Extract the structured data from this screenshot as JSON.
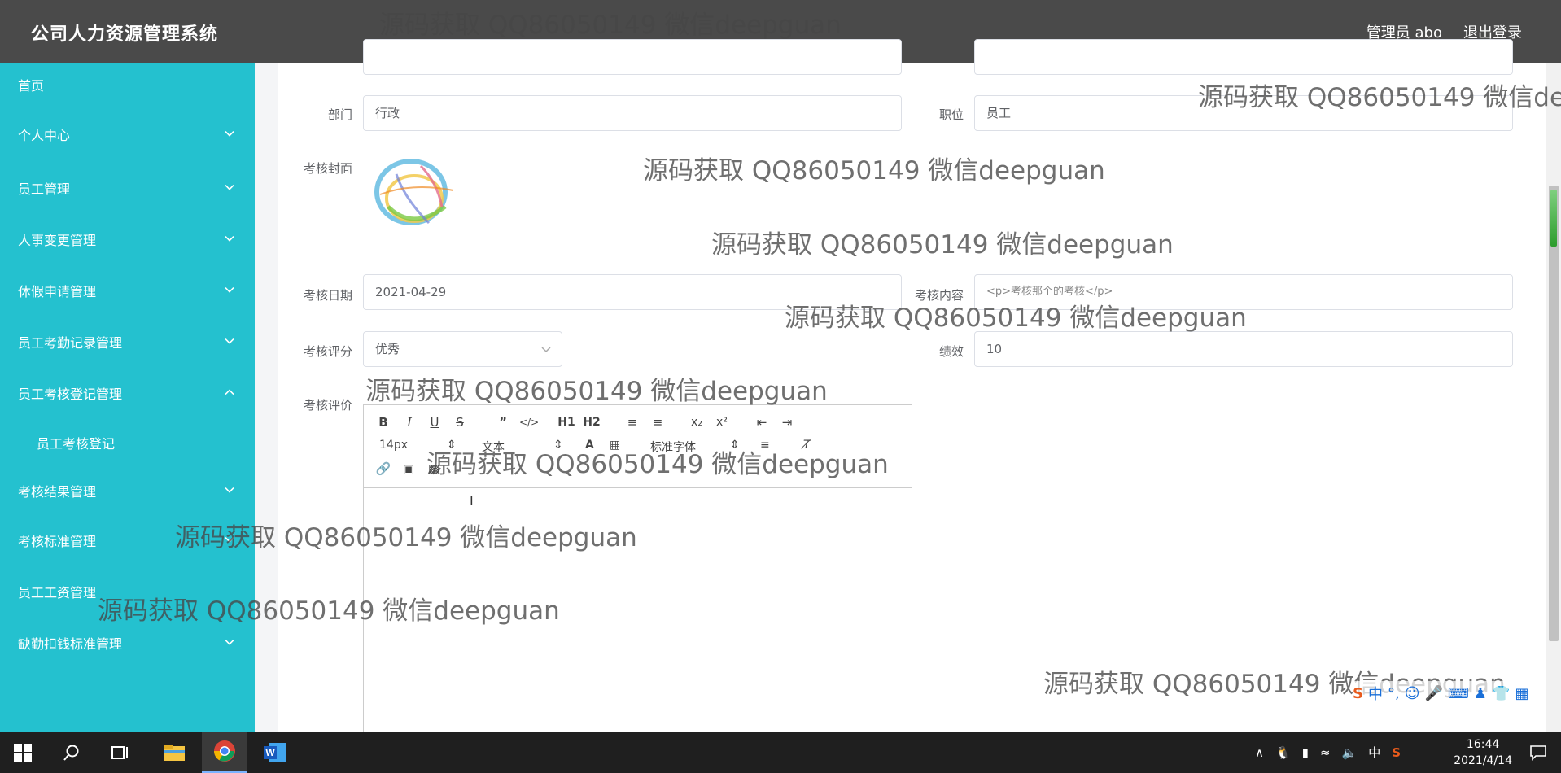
{
  "header": {
    "title": "公司人力资源管理系统",
    "user": "管理员 abo",
    "logout": "退出登录"
  },
  "sidebar": {
    "items": [
      {
        "label": "首页"
      },
      {
        "label": "个人中心"
      },
      {
        "label": "员工管理"
      },
      {
        "label": "人事变更管理"
      },
      {
        "label": "休假申请管理"
      },
      {
        "label": "员工考勤记录管理"
      },
      {
        "label": "员工考核登记管理"
      },
      {
        "label": "员工考核登记"
      },
      {
        "label": "考核结果管理"
      },
      {
        "label": "考核标准管理"
      },
      {
        "label": "员工工资管理"
      },
      {
        "label": "缺勤扣钱标准管理"
      }
    ]
  },
  "form": {
    "dept_label": "部门",
    "dept_value": "行政",
    "position_label": "职位",
    "position_value": "员工",
    "cover_label": "考核封面",
    "date_label": "考核日期",
    "date_value": "2021-04-29",
    "content_label": "考核内容",
    "content_value": "<p>考核那个的考核</p>",
    "rating_label": "考核评分",
    "rating_value": "优秀",
    "perf_label": "绩效",
    "perf_value": "10",
    "comment_label": "考核评价"
  },
  "editor": {
    "font_size": "14px",
    "paragraph": "文本",
    "font_family": "标准字体",
    "h1": "H1",
    "h2": "H2"
  },
  "watermark": "源码获取 QQ86050149 微信deepguan",
  "taskbar": {
    "ime_lang": "中",
    "time": "16:44",
    "date": "2021/4/14"
  },
  "ime": {
    "lang": "中"
  },
  "colors": {
    "sidebar": "#24c1cf",
    "header": "#4a4a4a",
    "taskbar": "#1f1f1f"
  }
}
